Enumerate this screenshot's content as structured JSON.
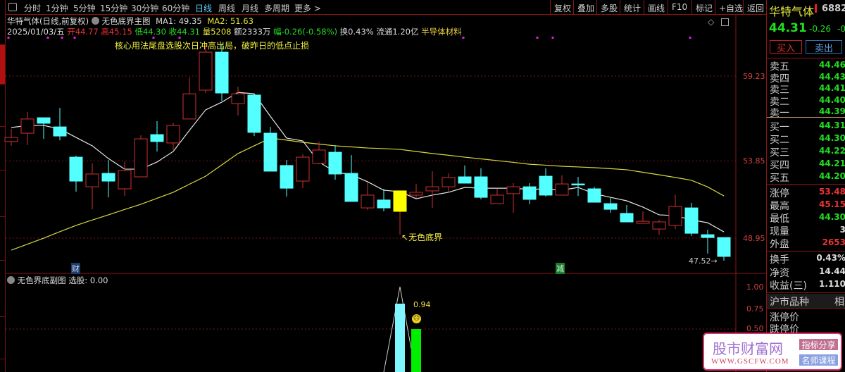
{
  "toolbar": {
    "tabs": [
      "分时",
      "1分钟",
      "5分钟",
      "15分钟",
      "30分钟",
      "60分钟",
      "日线",
      "周线",
      "月线",
      "多周期",
      "更多 >"
    ],
    "active": "日线",
    "buttons": [
      "复权",
      "叠加",
      "多股",
      "统计",
      "画线",
      "F10",
      "标记",
      "+自选",
      "返回"
    ]
  },
  "header": {
    "title": "华特气体(日线,前复权)",
    "indicator": "无色底界主图",
    "ma1": "MA1: 49.35",
    "ma2": "MA2: 51.63",
    "date": "2025/01/03/五",
    "open": "开44.77",
    "high": "高45.15",
    "low": "低44.30",
    "close": "收44.31",
    "vol": "量5208",
    "amount": "额2333万",
    "change": "幅-0.26(-0.58%)",
    "turnover": "换0.43%",
    "float": "流通1.20亿",
    "sector": "半导体材料",
    "note": "核心用法尾盘选股次日冲高出局，破昨日的低点止损"
  },
  "main_chart": {
    "axis_labels": [
      "59.23",
      "53.85",
      "48.95"
    ],
    "signal_label": "无色底界",
    "low_label": "47.52",
    "markers": [
      "财",
      "减"
    ],
    "candles": [
      [
        55.08,
        55.34,
        55.88,
        54.81
      ],
      [
        55.61,
        56.51,
        56.95,
        54.85
      ],
      [
        56.59,
        56.24,
        56.59,
        55.25
      ],
      [
        56.01,
        55.43,
        57.22,
        55.16
      ],
      [
        54.09,
        52.57,
        54.18,
        51.9
      ],
      [
        52.21,
        53.02,
        53.69,
        50.78
      ],
      [
        53.06,
        52.57,
        53.91,
        51.54
      ],
      [
        52.08,
        53.24,
        53.8,
        51.63
      ],
      [
        52.84,
        55.25,
        55.48,
        52.84
      ],
      [
        55.52,
        55.08,
        56.37,
        54.45
      ],
      [
        54.99,
        56.1,
        56.28,
        54.54
      ],
      [
        56.51,
        58.11,
        59.14,
        56.51
      ],
      [
        58.34,
        60.75,
        61.29,
        58.16
      ],
      [
        60.75,
        58.16,
        61.29,
        57.67
      ],
      [
        57.49,
        58.11,
        58.56,
        56.73
      ],
      [
        58.03,
        55.66,
        58.03,
        55.43
      ],
      [
        55.61,
        53.2,
        56.01,
        53.2
      ],
      [
        53.56,
        52.12,
        53.91,
        51.59
      ],
      [
        52.57,
        54.09,
        54.27,
        52.12
      ],
      [
        53.69,
        54.54,
        55.08,
        53.64
      ],
      [
        54.4,
        53.02,
        54.85,
        52.66
      ],
      [
        53.06,
        51.28,
        54.22,
        51.28
      ],
      [
        50.87,
        51.68,
        52.48,
        50.74
      ],
      [
        51.37,
        50.87,
        52.08,
        50.65
      ],
      [
        51.95,
        50.65,
        51.95,
        49.17
      ],
      [
        51.68,
        51.86,
        52.39,
        51.5
      ],
      [
        51.95,
        52.21,
        53.2,
        50.87
      ],
      [
        52.21,
        52.8,
        53.06,
        51.81
      ],
      [
        52.84,
        52.44,
        53.56,
        52.44
      ],
      [
        52.84,
        51.54,
        53.38,
        51.41
      ],
      [
        51.14,
        51.68,
        52.08,
        51.14
      ],
      [
        51.77,
        52.21,
        52.44,
        50.56
      ],
      [
        52.21,
        51.41,
        52.44,
        51.1
      ],
      [
        52.88,
        51.68,
        53.38,
        51.59
      ],
      [
        51.68,
        52.39,
        52.93,
        51.68
      ],
      [
        52.39,
        52.39,
        52.84,
        51.63
      ],
      [
        52.08,
        51.23,
        52.21,
        51.23
      ],
      [
        51.14,
        50.78,
        51.5,
        50.56
      ],
      [
        50.52,
        49.98,
        51.05,
        49.98
      ],
      [
        49.89,
        50.02,
        50.65,
        49.89
      ],
      [
        49.53,
        49.98,
        50.11,
        49.17
      ],
      [
        49.76,
        50.96,
        51.72,
        49.53
      ],
      [
        50.87,
        49.26,
        51.19,
        49.08
      ],
      [
        49.17,
        48.99,
        49.49,
        47.97
      ],
      [
        48.99,
        47.79,
        48.99,
        47.52
      ]
    ],
    "signal_index": 24,
    "ma1": [
      55.97,
      56.1,
      56.1,
      55.88,
      55.34,
      54.81,
      54.0,
      53.33,
      53.33,
      53.78,
      54.45,
      55.79,
      57.09,
      57.58,
      58.2,
      58.11,
      56.68,
      55.3,
      55.12,
      53.78,
      53.15,
      52.97,
      52.53,
      51.99,
      51.9,
      51.45,
      51.68,
      51.86,
      52.17,
      52.12,
      52.12,
      52.12,
      52.04,
      52.08,
      51.99,
      52.17,
      51.77,
      51.54,
      51.32,
      50.92,
      50.43,
      50.38,
      50.11,
      49.93,
      49.35
    ],
    "ma2": [
      48.19,
      48.57,
      48.95,
      49.36,
      49.76,
      50.1,
      50.43,
      50.77,
      51.1,
      51.48,
      51.86,
      52.37,
      52.88,
      53.6,
      54.32,
      54.81,
      55.3,
      55.17,
      55.03,
      54.92,
      54.81,
      54.74,
      54.67,
      54.63,
      54.58,
      54.45,
      54.32,
      54.21,
      54.09,
      53.98,
      53.87,
      53.76,
      53.64,
      53.58,
      53.51,
      53.47,
      53.42,
      53.36,
      53.29,
      53.13,
      52.97,
      52.8,
      52.62,
      52.2,
      51.63
    ],
    "colors": {
      "up": "#d03030",
      "down": "#54ffff",
      "signal": "#ffff00",
      "ma1": "#e6e6e6",
      "ma2": "#d8d840"
    }
  },
  "sub_chart": {
    "title": "无色界底副图",
    "select": "选股: 0.00",
    "axis_labels": [
      "1.00",
      "0.75",
      "0.50"
    ],
    "value_label": "0.94",
    "bars": [
      {
        "value": 0.8,
        "color": "#7ff5ff"
      },
      {
        "value": 0.5,
        "color": "#00ee00"
      }
    ]
  },
  "right_panel": {
    "name": "华特气体",
    "code": "6882",
    "price": "44.31",
    "change": "-0.26",
    "change_pct": "-0",
    "buy_btn": "买入",
    "sell_btn": "卖出",
    "asks": [
      [
        "卖五",
        "44.46"
      ],
      [
        "卖四",
        "44.43"
      ],
      [
        "卖三",
        "44.41"
      ],
      [
        "卖二",
        "44.40"
      ],
      [
        "卖一",
        "44.39"
      ]
    ],
    "bids": [
      [
        "买一",
        "44.31"
      ],
      [
        "买二",
        "44.30"
      ],
      [
        "买三",
        "44.22"
      ],
      [
        "买四",
        "44.21"
      ],
      [
        "买五",
        "44.20"
      ]
    ],
    "stats": [
      [
        "涨停",
        "53.48"
      ],
      [
        "最高",
        "45.15"
      ],
      [
        "最低",
        "44.30"
      ],
      [
        "现量",
        "3"
      ],
      [
        "外盘",
        "2653"
      ]
    ],
    "stats2": [
      [
        "换手",
        "0.43%"
      ],
      [
        "净资",
        "14.44"
      ],
      [
        "收益(三)",
        "1.110"
      ]
    ],
    "section": "沪市品种",
    "section_right": "相",
    "limit_up": "涨停价",
    "limit_down": "跌停价"
  },
  "watermark": {
    "name": "股市财富网",
    "url": "WWW.GSCFW.COM",
    "tag1": "指标分享",
    "tag2": "名师课程"
  }
}
